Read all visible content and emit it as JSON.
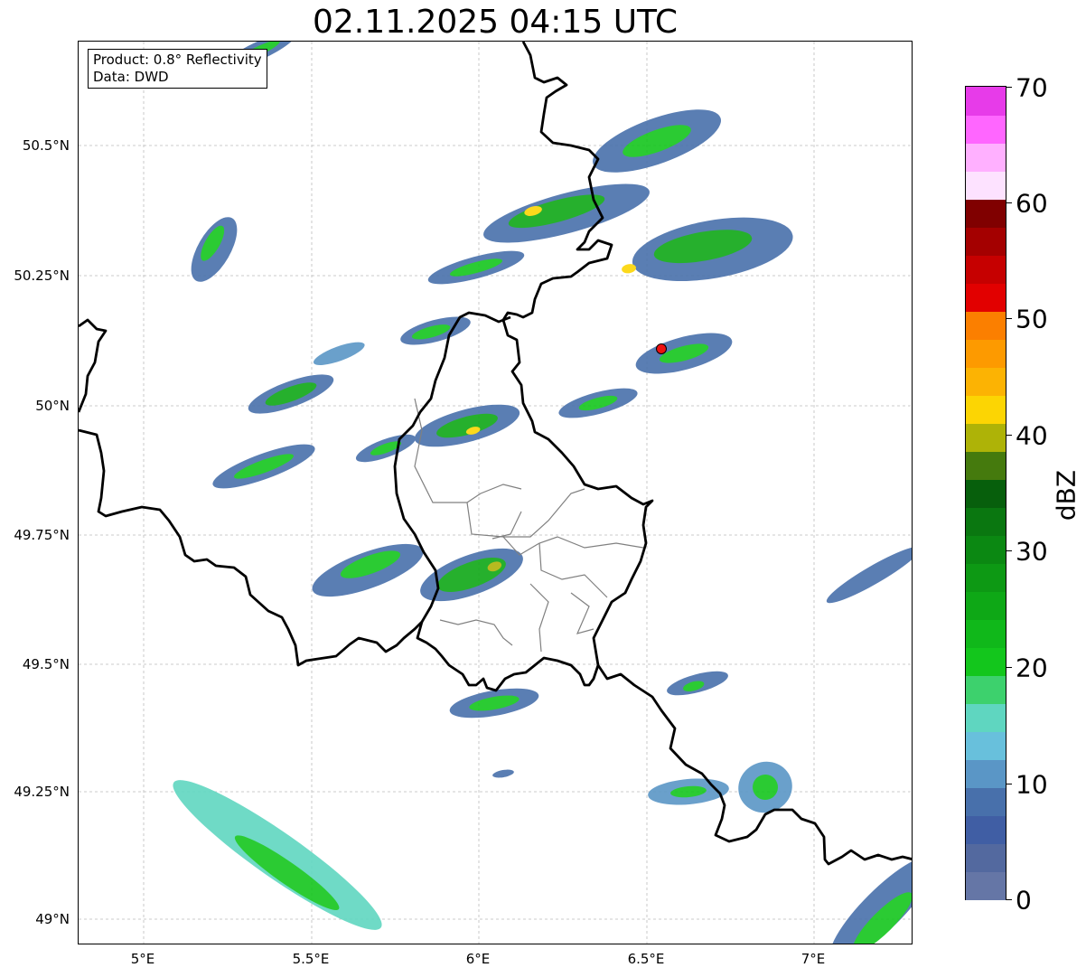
{
  "title": "02.11.2025 04:15 UTC",
  "info_box": {
    "line1": "Product: 0.8° Reflectivity",
    "line2": "Data: DWD"
  },
  "lat_ticks": [
    "50.5°N",
    "50.25°N",
    "50°N",
    "49.75°N",
    "49.5°N",
    "49.25°N",
    "49°N"
  ],
  "lon_ticks": [
    "5°E",
    "5.5°E",
    "6°E",
    "6.5°E",
    "7°E"
  ],
  "colorbar": {
    "label": "dBZ",
    "ticks": [
      "0",
      "10",
      "20",
      "30",
      "40",
      "50",
      "60",
      "70"
    ],
    "colors": [
      "#6576a6",
      "#53699f",
      "#405ea4",
      "#4870ab",
      "#5a96c6",
      "#68c0dc",
      "#5fd6c0",
      "#3dd16d",
      "#13c61c",
      "#10b81a",
      "#0ea816",
      "#0d9914",
      "#0b8812",
      "#0a7710",
      "#075f0c",
      "#457a0d",
      "#aeb307",
      "#fcd503",
      "#fcb303",
      "#fd9a00",
      "#fb7f00",
      "#e20000",
      "#c60000",
      "#a40000",
      "#800000",
      "#fde2ff",
      "#ffb0ff",
      "#ff66ff",
      "#e73be9"
    ]
  },
  "marker": {
    "color": "#ee1111"
  }
}
